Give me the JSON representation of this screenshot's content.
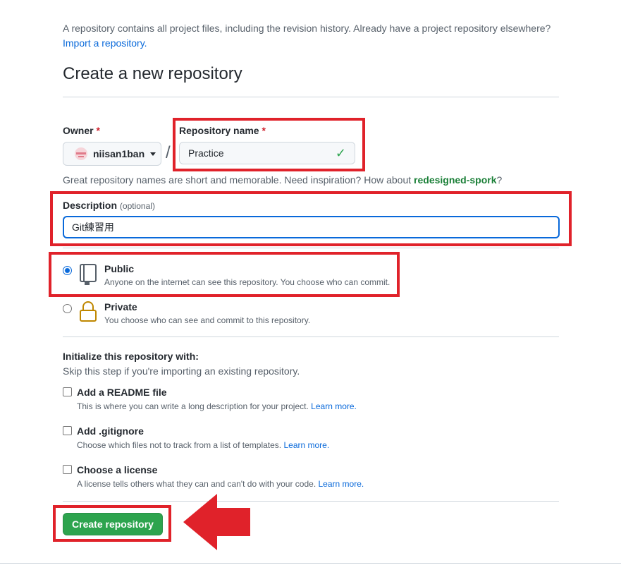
{
  "intro": {
    "text": "A repository contains all project files, including the revision history. Already have a project repository elsewhere?",
    "import_link": "Import a repository."
  },
  "page_title": "Create a new repository",
  "owner": {
    "label": "Owner",
    "required_mark": "*",
    "value": "niisan1ban"
  },
  "slash": "/",
  "repo_name": {
    "label": "Repository name",
    "required_mark": "*",
    "value": "Practice"
  },
  "name_hint": {
    "text": "Great repository names are short and memorable. Need inspiration? How about",
    "suggestion": "redesigned-spork",
    "end": "?"
  },
  "description": {
    "label": "Description",
    "optional": "(optional)",
    "value": "Git練習用"
  },
  "visibility": {
    "public": {
      "label": "Public",
      "desc": "Anyone on the internet can see this repository. You choose who can commit.",
      "selected": true
    },
    "private": {
      "label": "Private",
      "desc": "You choose who can see and commit to this repository.",
      "selected": false
    }
  },
  "init": {
    "title": "Initialize this repository with:",
    "subtitle": "Skip this step if you're importing an existing repository.",
    "options": [
      {
        "label": "Add a README file",
        "desc": "This is where you can write a long description for your project.",
        "link": "Learn more."
      },
      {
        "label": "Add .gitignore",
        "desc": "Choose which files not to track from a list of templates.",
        "link": "Learn more."
      },
      {
        "label": "Choose a license",
        "desc": "A license tells others what they can and can't do with your code.",
        "link": "Learn more."
      }
    ]
  },
  "create_button": "Create repository",
  "colors": {
    "accent_blue": "#0969da",
    "success_green": "#2da44e",
    "highlight_red": "#e0222a",
    "lock_gold": "#bf8700"
  }
}
